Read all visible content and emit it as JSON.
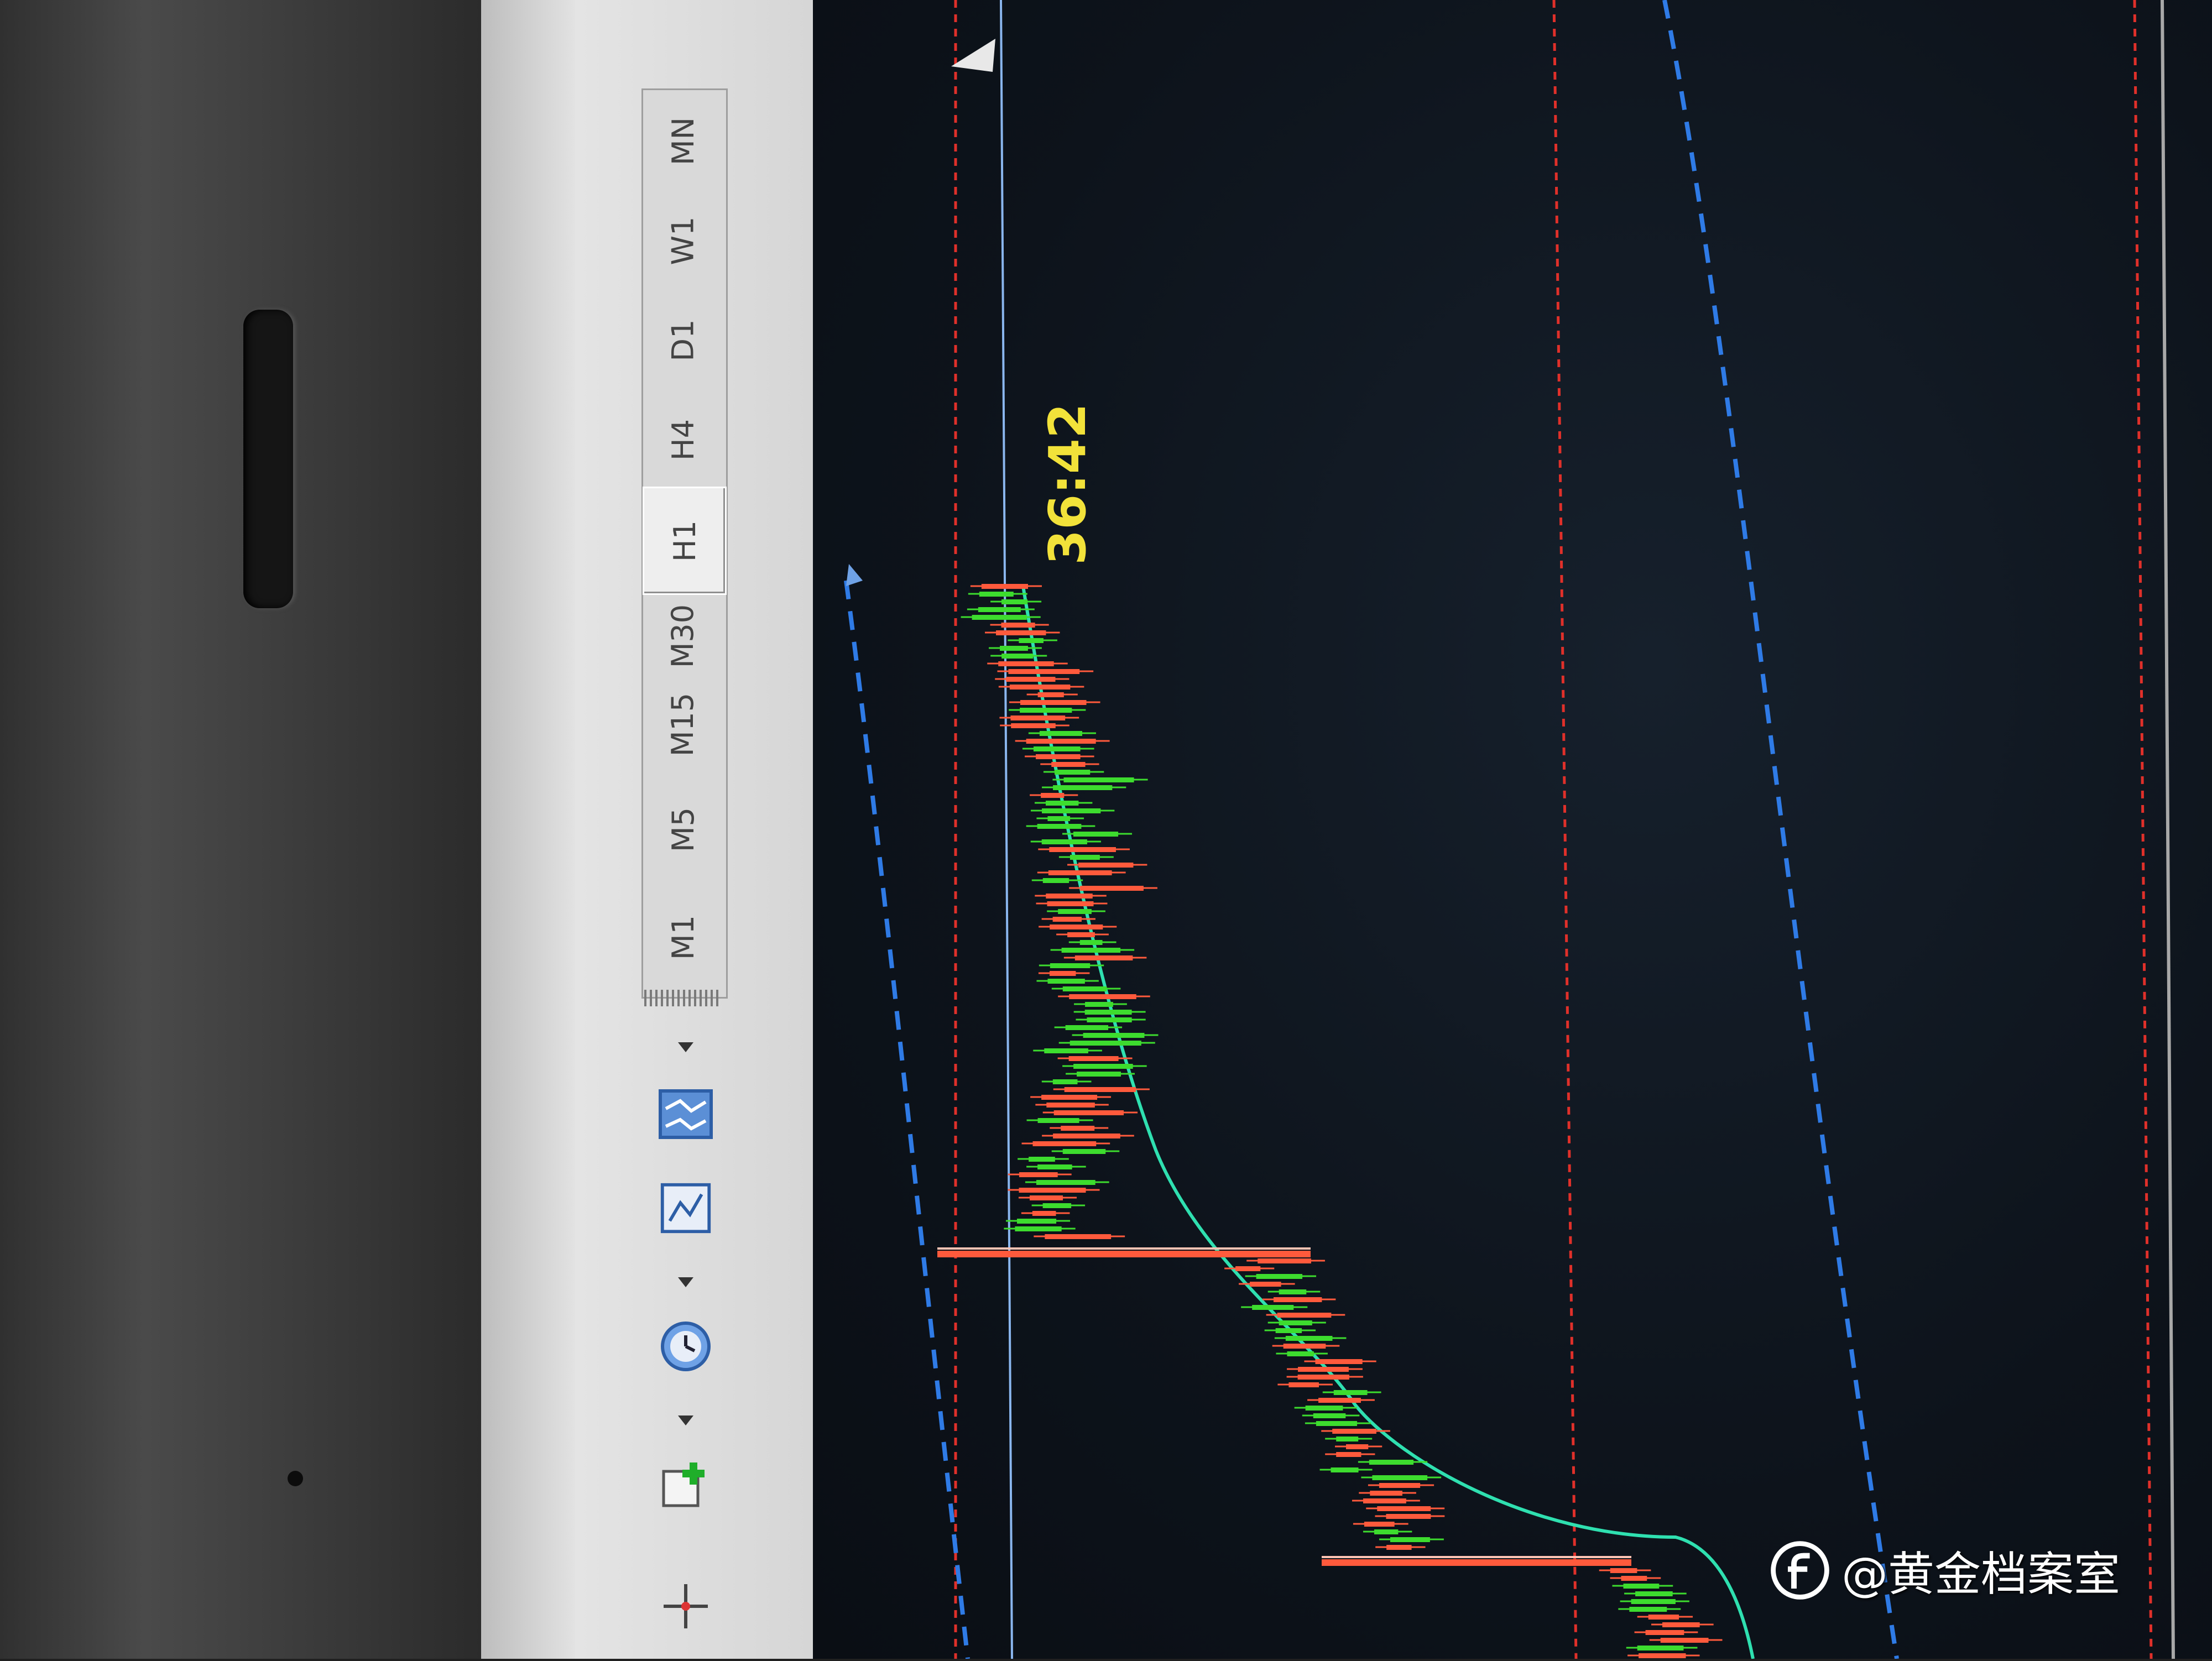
{
  "toolbar": {
    "timeframes": [
      "M1",
      "M5",
      "M15",
      "M30",
      "H1",
      "H4",
      "D1",
      "W1",
      "MN"
    ],
    "active_timeframe": "H1",
    "tool_icons": [
      "new-order-icon",
      "clock-icon",
      "chart-template-icon",
      "chart-properties-icon",
      "crosshair-icon"
    ]
  },
  "chart": {
    "countdown": "36:42",
    "colors": {
      "background": "#0d131b",
      "bull_candle": "#3ddc2e",
      "bear_candle": "#ff5a3c",
      "moving_average": "#2fe0b0",
      "channel_line": "#2f7be6",
      "period_separator": "#e0302a",
      "countdown": "#f2e23a"
    }
  },
  "watermark": {
    "text": "@黄金档案室",
    "icon": "toutiao-logo-icon"
  }
}
